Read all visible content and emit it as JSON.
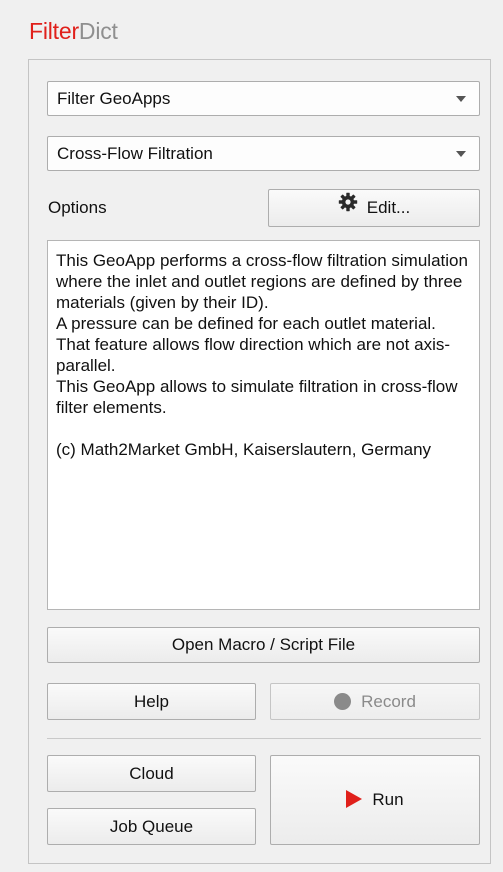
{
  "app": {
    "title_accent": "Filter",
    "title_rest": "Dict"
  },
  "selectors": {
    "category": "Filter GeoApps",
    "geoapp": "Cross-Flow Filtration"
  },
  "options": {
    "label": "Options",
    "edit_label": "Edit..."
  },
  "description": {
    "lines": [
      "This GeoApp performs a cross-flow filtration simulation where the inlet and outlet regions are defined by three materials (given by their ID).",
      "A pressure can be defined for each outlet material.",
      "That feature allows flow direction which are not axis-parallel.",
      "This GeoApp allows to simulate filtration in cross-flow filter elements.",
      "(c) Math2Market GmbH, Kaiserslautern, Germany"
    ]
  },
  "buttons": {
    "open_macro": "Open Macro / Script File",
    "help": "Help",
    "record": "Record",
    "cloud": "Cloud",
    "job_queue": "Job Queue",
    "run": "Run"
  },
  "icons": {
    "edit": "gear-icon",
    "record": "record-dot-icon",
    "run": "play-icon"
  },
  "colors": {
    "accent": "#e0201b",
    "title_secondary": "#8f8f8f",
    "disabled": "#8a8a8a"
  }
}
